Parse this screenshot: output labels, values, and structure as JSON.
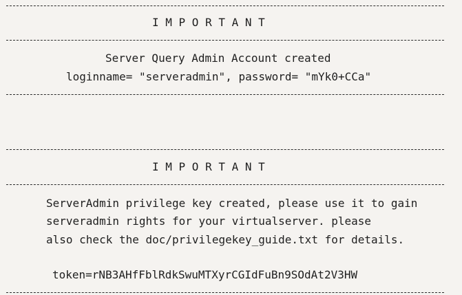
{
  "console": {
    "block1": {
      "heading": "I M P O R T A N T",
      "line1": "Server Query Admin Account created",
      "line2": "loginname= \"serveradmin\", password= \"mYk0+CCa\""
    },
    "block2": {
      "heading": "I M P O R T A N T",
      "line1": "ServerAdmin privilege key created, please use it to gain",
      "line2": "serveradmin rights for your virtualserver. please",
      "line3": "also check the doc/privilegekey_guide.txt for details.",
      "token": "token=rNB3AHfFblRdkSwuMTXyrCGIdFuBn9SOdAt2V3HW"
    }
  }
}
